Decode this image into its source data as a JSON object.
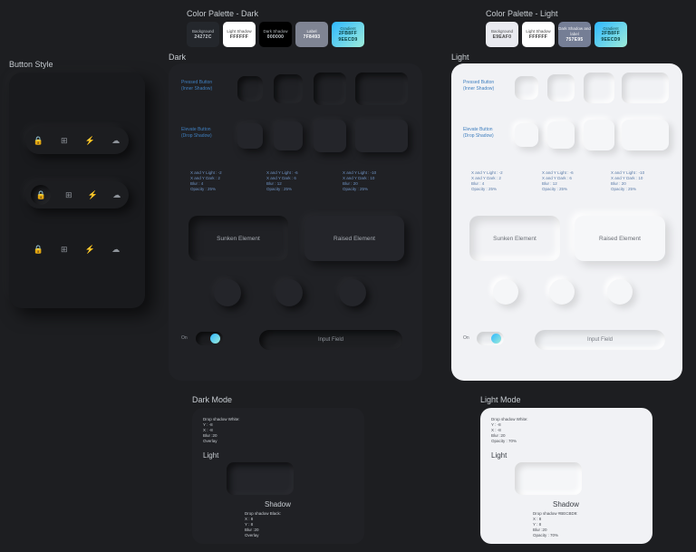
{
  "titles": {
    "button_style": "Button Style",
    "palette_dark": "Color Palette - Dark",
    "palette_light": "Color Palette - Light",
    "dark": "Dark",
    "light": "Light",
    "dark_mode": "Dark Mode",
    "light_mode": "Light Mode"
  },
  "palette_dark": [
    {
      "label": "Background",
      "hex": "24272C",
      "bg": "#24272c",
      "fg": "#c7ccd1"
    },
    {
      "label": "Light Shadow",
      "hex": "FFFFFF",
      "bg": "#ffffff",
      "fg": "#333"
    },
    {
      "label": "Dark Shadow",
      "hex": "000000",
      "bg": "#000000",
      "fg": "#c7ccd1"
    },
    {
      "label": "Label",
      "hex": "7F8493",
      "bg": "#7f8493",
      "fg": "#fff"
    },
    {
      "label": "Gradient",
      "hex": "2FB8FF 9EECD9",
      "bg": "linear-gradient(135deg,#2fb8ff,#9eecd9)",
      "fg": "#083b3b"
    }
  ],
  "palette_light": [
    {
      "label": "Background",
      "hex": "E9EAF0",
      "bg": "#e9eaf0",
      "fg": "#444"
    },
    {
      "label": "Light Shadow",
      "hex": "FFFFFF",
      "bg": "#ffffff",
      "fg": "#333"
    },
    {
      "label": "Dark Shadow and label",
      "hex": "757E95",
      "bg": "#757e95",
      "fg": "#fff"
    },
    {
      "label": "Gradient",
      "hex": "2FB8FF 9EECD9",
      "bg": "linear-gradient(135deg,#2fb8ff,#9eecd9)",
      "fg": "#083b3b"
    }
  ],
  "labels": {
    "pressed": "Pressed Button\n(Inner Shadow)",
    "elevate": "Elevate Button\n(Drop Shadow)",
    "sunken": "Sunken Element",
    "raised": "Raised Element",
    "on": "On",
    "input": "Input Field",
    "shadow": "Shadow",
    "light_word": "Light"
  },
  "specs_dark": [
    "X and Y Light : -2\nX and Y Dark : 2\nBlur : 4\nOpacity : 25%",
    "X and Y Light : -6\nX and Y Dark : 6\nBlur : 12\nOpacity : 25%",
    "X and Y Light : -10\nX and Y Dark : 10\nBlur : 20\nOpacity : 25%"
  ],
  "specs_light": [
    "X and Y Light : -2\nX and Y Dark : 2\nBlur : 4\nOpacity : 25%",
    "X and Y Light : -6\nX and Y Dark : 6\nBlur : 12\nOpacity : 25%",
    "X and Y Light : -10\nX and Y Dark : 10\nBlur : 20\nOpacity : 25%"
  ],
  "mode_dark": {
    "top": "Drop shadow White:\nY : -8\nX : -8\nBlur :20\nOverlay",
    "mid": "Light",
    "shadow_title": "Shadow",
    "bot": "Drop shadow Black:\nX : 8\nY : 8\nBlur :20\nOverlay"
  },
  "mode_light": {
    "top": "Drop shadow White:\nY : -8\nX : -8\nBlur :20\nOpacity : 70%",
    "mid": "Light",
    "shadow_title": "Shadow",
    "bot": "Drop shadow #BECBD9:\nX : 8\nY : 8\nBlur :20\nOpacity : 70%"
  },
  "icons": [
    "lock",
    "grid",
    "bolt",
    "cloud"
  ]
}
